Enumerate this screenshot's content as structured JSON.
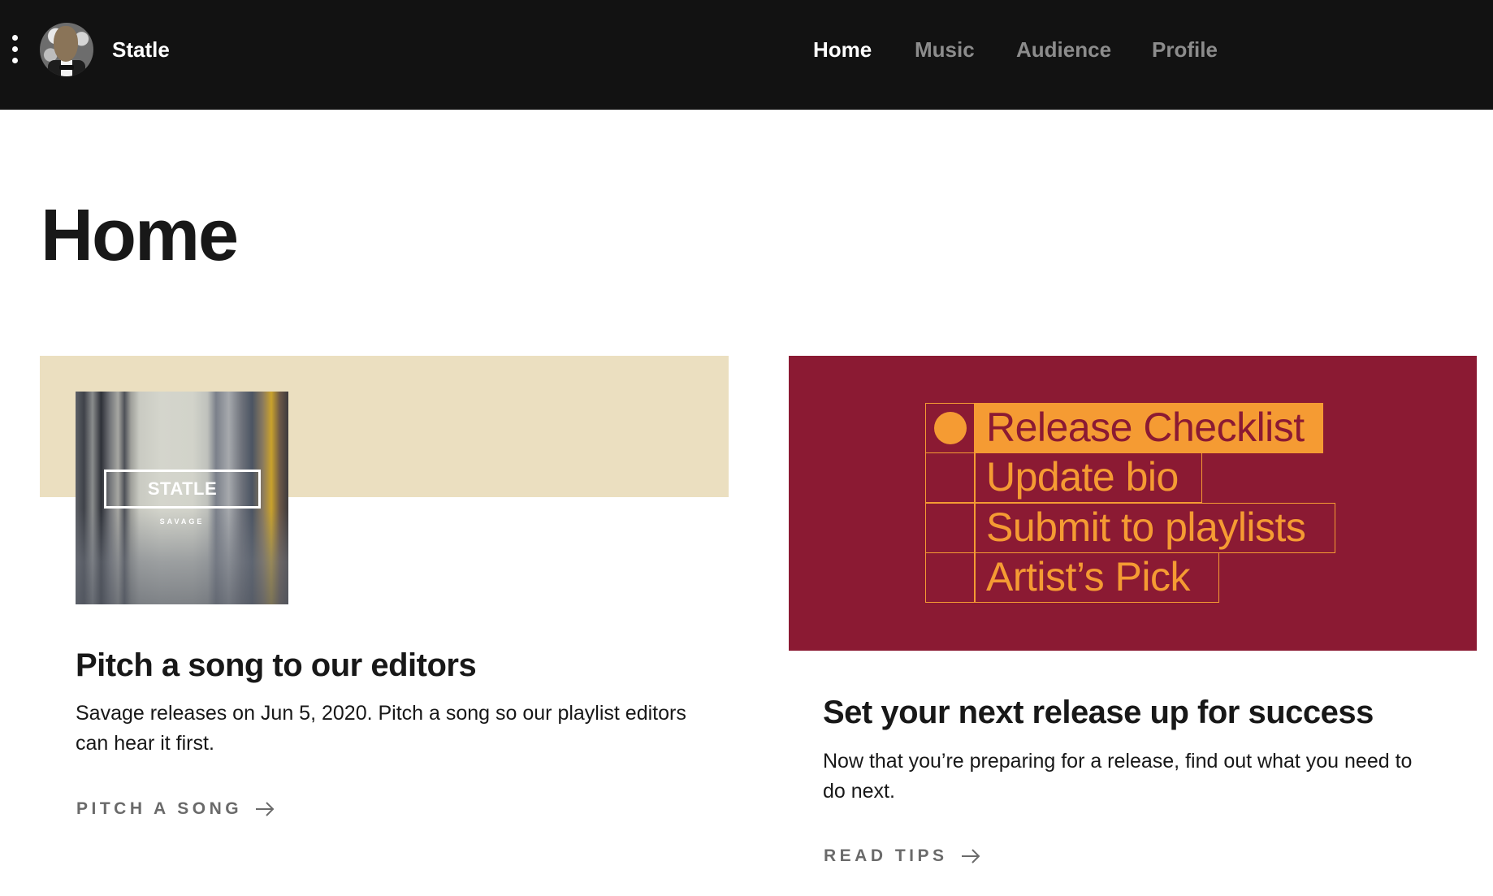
{
  "header": {
    "menu_icon": "kebab-menu-icon",
    "avatar_icon": "artist-avatar",
    "artist_name": "Statle",
    "nav": [
      {
        "label": "Home",
        "active": true
      },
      {
        "label": "Music",
        "active": false
      },
      {
        "label": "Audience",
        "active": false
      },
      {
        "label": "Profile",
        "active": false
      }
    ]
  },
  "page": {
    "title": "Home"
  },
  "cards": [
    {
      "album_art": {
        "artist": "STATLE",
        "title": "SAVAGE"
      },
      "title": "Pitch a song to our editors",
      "body": "Savage releases on Jun 5, 2020. Pitch a song so our playlist editors can hear it first.",
      "link_label": "PITCH A SONG",
      "link_icon": "arrow-right-icon"
    },
    {
      "checklist": [
        {
          "label": "Release Checklist",
          "checked": true
        },
        {
          "label": "Update bio",
          "checked": false
        },
        {
          "label": "Submit to playlists",
          "checked": false
        },
        {
          "label": "Artist’s Pick",
          "checked": false
        }
      ],
      "title": "Set your next release up for success",
      "body": "Now that you’re preparing for a release, find out what you need to do next.",
      "link_label": "READ TIPS",
      "link_icon": "arrow-right-icon"
    }
  ],
  "colors": {
    "header_bg": "#121212",
    "nav_inactive": "#8c8c8c",
    "beige": "#ebdfc0",
    "crimson": "#8b1a33",
    "orange": "#f59b33",
    "link_gray": "#6a6a6a"
  }
}
